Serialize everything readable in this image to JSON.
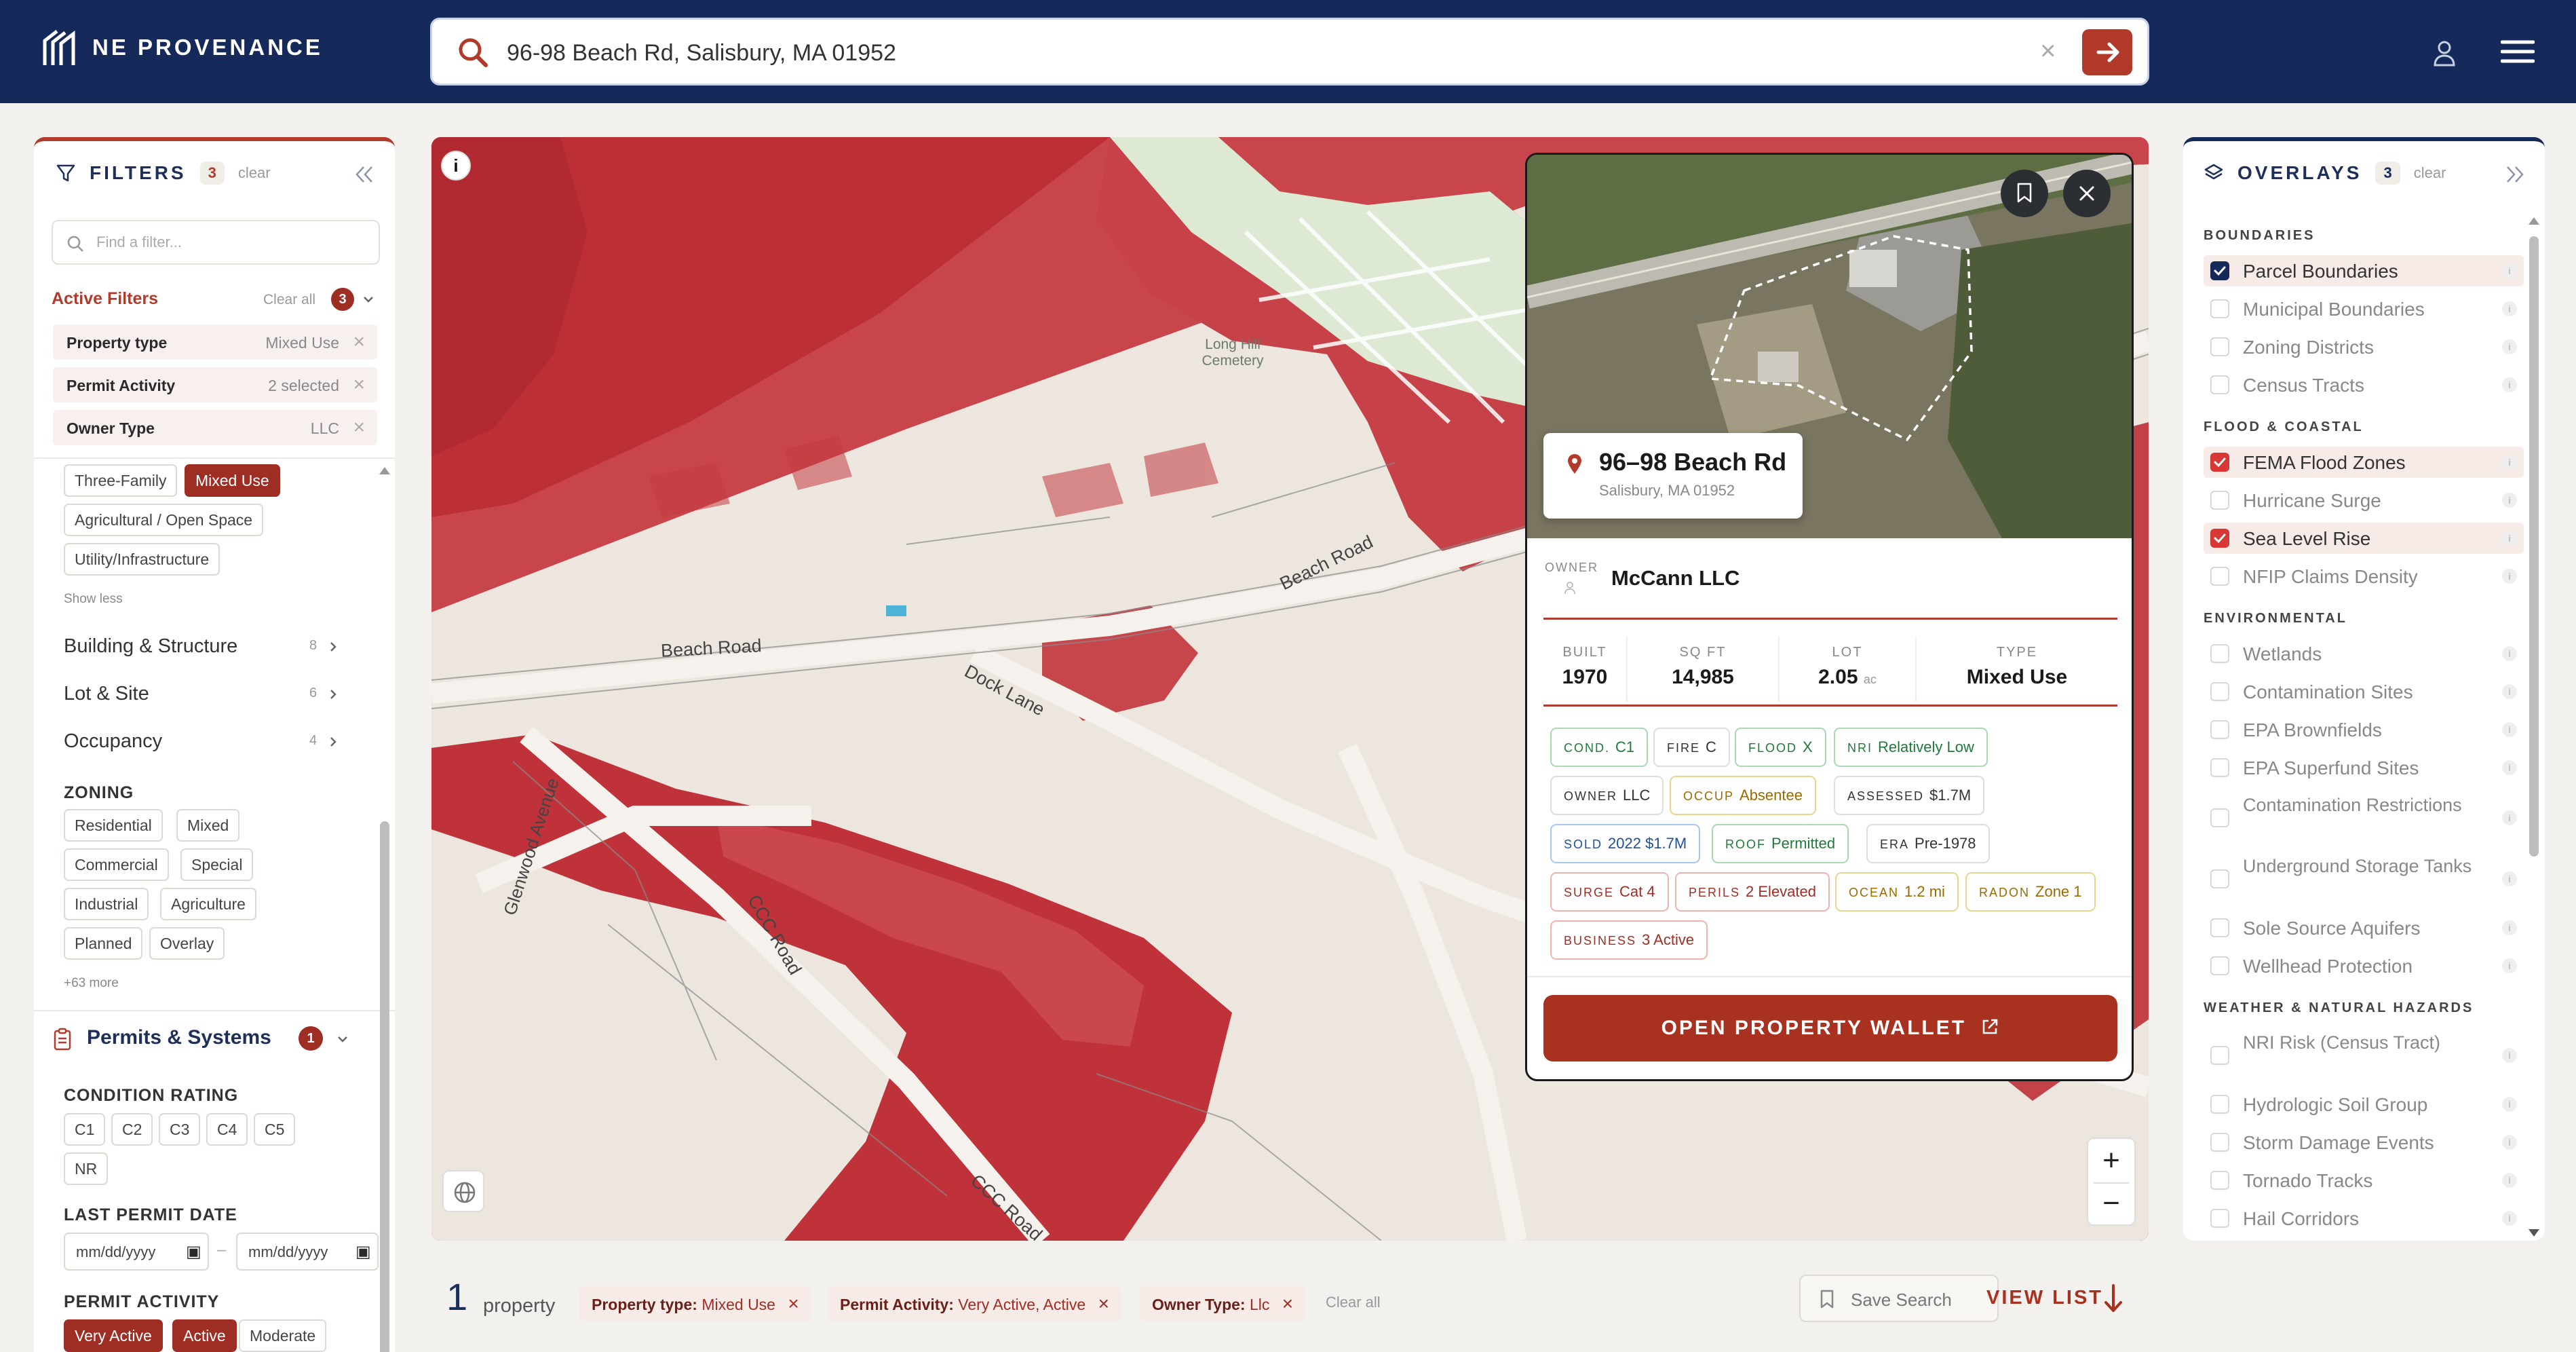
{
  "brand": {
    "name": "NE PROVENANCE"
  },
  "search": {
    "value": "96-98 Beach Rd, Salisbury, MA 01952"
  },
  "filters": {
    "title": "FILTERS",
    "count": "3",
    "clear": "clear",
    "find_placeholder": "Find a filter...",
    "active_title": "Active Filters",
    "active_clear": "Clear all",
    "active_count": "3",
    "active": [
      {
        "key": "Property type",
        "value": "Mixed Use"
      },
      {
        "key": "Permit Activity",
        "value": "2 selected"
      },
      {
        "key": "Owner Type",
        "value": "LLC"
      }
    ],
    "property_types": [
      "Three-Family",
      "Mixed Use",
      "Agricultural / Open Space",
      "Utility/Infrastructure"
    ],
    "show_less": "Show less",
    "categories": [
      {
        "label": "Building & Structure",
        "n": "8"
      },
      {
        "label": "Lot & Site",
        "n": "6"
      },
      {
        "label": "Occupancy",
        "n": "4"
      }
    ],
    "zoning_title": "ZONING",
    "zoning": [
      "Residential",
      "Mixed",
      "Commercial",
      "Special",
      "Industrial",
      "Agriculture",
      "Planned",
      "Overlay"
    ],
    "zoning_more": "+63 more",
    "permits_title": "Permits & Systems",
    "permits_count": "1",
    "condition_title": "CONDITION RATING",
    "conditions": [
      "C1",
      "C2",
      "C3",
      "C4",
      "C5",
      "NR"
    ],
    "last_permit_title": "LAST PERMIT DATE",
    "date_from": "mm/dd/yyyy",
    "date_to": "mm/dd/yyyy",
    "permit_activity_title": "PERMIT ACTIVITY",
    "permit_activity": [
      "Very Active",
      "Active",
      "Moderate"
    ]
  },
  "overlays": {
    "title": "OVERLAYS",
    "count": "3",
    "clear": "clear",
    "sections": [
      {
        "title": "BOUNDARIES",
        "items": [
          {
            "label": "Parcel Boundaries",
            "checked": true,
            "color": "#15295a"
          },
          {
            "label": "Municipal Boundaries",
            "checked": false
          },
          {
            "label": "Zoning Districts",
            "checked": false
          },
          {
            "label": "Census Tracts",
            "checked": false
          }
        ]
      },
      {
        "title": "FLOOD & COASTAL",
        "items": [
          {
            "label": "FEMA Flood Zones",
            "checked": true,
            "color": "#d93636"
          },
          {
            "label": "Hurricane Surge",
            "checked": false
          },
          {
            "label": "Sea Level Rise",
            "checked": true,
            "color": "#d93636"
          },
          {
            "label": "NFIP Claims Density",
            "checked": false
          }
        ]
      },
      {
        "title": "ENVIRONMENTAL",
        "items": [
          {
            "label": "Wetlands",
            "checked": false
          },
          {
            "label": "Contamination Sites",
            "checked": false
          },
          {
            "label": "EPA Brownfields",
            "checked": false
          },
          {
            "label": "EPA Superfund Sites",
            "checked": false
          },
          {
            "label": "Contamination Restrictions",
            "checked": false
          },
          {
            "label": "Underground Storage Tanks",
            "checked": false
          },
          {
            "label": "Sole Source Aquifers",
            "checked": false
          },
          {
            "label": "Wellhead Protection",
            "checked": false
          }
        ]
      },
      {
        "title": "WEATHER & NATURAL HAZARDS",
        "items": [
          {
            "label": "NRI Risk (Census Tract)",
            "checked": false
          },
          {
            "label": "Hydrologic Soil Group",
            "checked": false
          },
          {
            "label": "Storm Damage Events",
            "checked": false
          },
          {
            "label": "Tornado Tracks",
            "checked": false
          },
          {
            "label": "Hail Corridors",
            "checked": false
          }
        ]
      }
    ]
  },
  "map": {
    "labels": {
      "cemetery": "Long Hill Cemetery",
      "beach_road": "Beach Road",
      "beach_road2": "Beach Road",
      "dock_lane": "Dock Lane",
      "glenwood": "Glenwood Avenue",
      "ccc": "CCC Road",
      "ccc2": "CCC Road"
    }
  },
  "property": {
    "address": "96–98 Beach Rd",
    "city": "Salisbury, MA 01952",
    "owner_label": "OWNER",
    "owner": "McCann LLC",
    "stats": [
      {
        "label": "BUILT",
        "value": "1970"
      },
      {
        "label": "SQ FT",
        "value": "14,985"
      },
      {
        "label": "LOT",
        "value": "2.05",
        "unit": "ac"
      },
      {
        "label": "TYPE",
        "value": "Mixed Use"
      }
    ],
    "tags": [
      {
        "k": "COND.",
        "v": "C1",
        "c": "tg"
      },
      {
        "k": "FIRE",
        "v": "C",
        "c": "tk"
      },
      {
        "k": "FLOOD",
        "v": "X",
        "c": "tg"
      },
      {
        "k": "NRI",
        "v": "Relatively Low",
        "c": "tg"
      },
      {
        "k": "OWNER",
        "v": "LLC",
        "c": "tk"
      },
      {
        "k": "OCCUP",
        "v": "Absentee",
        "c": "ty"
      },
      {
        "k": "ASSESSED",
        "v": "$1.7M",
        "c": "tk"
      },
      {
        "k": "SOLD",
        "v": "2022 $1.7M",
        "c": "tb"
      },
      {
        "k": "ROOF",
        "v": "Permitted",
        "c": "tg"
      },
      {
        "k": "ERA",
        "v": "Pre-1978",
        "c": "tk"
      },
      {
        "k": "SURGE",
        "v": "Cat 4",
        "c": "tr"
      },
      {
        "k": "PERILS",
        "v": "2 Elevated",
        "c": "tr"
      },
      {
        "k": "OCEAN",
        "v": "1.2 mi",
        "c": "ty"
      },
      {
        "k": "RADON",
        "v": "Zone 1",
        "c": "ty"
      },
      {
        "k": "BUSINESS",
        "v": "3 Active",
        "c": "tr"
      }
    ],
    "open_button": "OPEN PROPERTY WALLET"
  },
  "footer": {
    "count": "1",
    "count_label": "property",
    "chips": [
      {
        "k": "Property type:",
        "v": "Mixed Use"
      },
      {
        "k": "Permit Activity:",
        "v": "Very Active, Active"
      },
      {
        "k": "Owner Type:",
        "v": "Llc"
      }
    ],
    "clear_all": "Clear all",
    "save_search": "Save Search",
    "view_list": "VIEW LIST"
  },
  "colors": {
    "navy": "#15295a",
    "accent": "#b23a2b",
    "flood": "#c9333b"
  }
}
